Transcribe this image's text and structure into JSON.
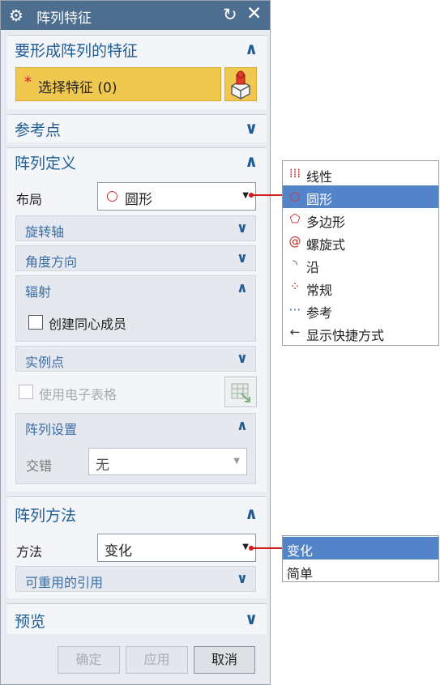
{
  "dialog": {
    "title": "阵列特征",
    "icons": {
      "title_icon": "gear-icon",
      "reset_icon": "reset-icon",
      "close_icon": "close-icon"
    }
  },
  "features": {
    "title": "要形成阵列的特征",
    "select_label": "选择特征 (0)",
    "required_marker": "*"
  },
  "reference": {
    "title": "参考点"
  },
  "definition": {
    "title": "阵列定义",
    "layout_label": "布局",
    "layout_value": "圆形",
    "rotation_axis": "旋转轴",
    "angle_direction": "角度方向",
    "radiate": {
      "title": "辐射",
      "concentric_label": "创建同心成员"
    },
    "instance_points": "实例点",
    "spreadsheet_label": "使用电子表格",
    "array_settings": {
      "title": "阵列设置",
      "stagger_label": "交错",
      "stagger_value": "无"
    }
  },
  "method": {
    "title": "阵列方法",
    "method_label": "方法",
    "method_value": "变化",
    "reusable_refs": "可重用的引用"
  },
  "preview": {
    "title": "预览"
  },
  "buttons": {
    "ok": "确定",
    "apply": "应用",
    "cancel": "取消"
  },
  "layout_menu": {
    "items": [
      {
        "label": "线性",
        "icon": "linear-grid-icon"
      },
      {
        "label": "圆形",
        "icon": "circular-icon",
        "selected": true
      },
      {
        "label": "多边形",
        "icon": "polygon-icon"
      },
      {
        "label": "螺旋式",
        "icon": "spiral-icon"
      },
      {
        "label": "沿",
        "icon": "along-curve-icon"
      },
      {
        "label": "常规",
        "icon": "general-icon"
      },
      {
        "label": "参考",
        "icon": "reference-icon"
      },
      {
        "label": "显示快捷方式",
        "icon": "shortcut-arrow-icon"
      }
    ]
  },
  "method_menu": {
    "items": [
      {
        "label": "变化",
        "selected": true
      },
      {
        "label": "简单"
      }
    ]
  },
  "colors": {
    "titlebar": "#4d6e8e",
    "section_title": "#1f5d97",
    "highlight": "#f0c850",
    "menu_selected": "#5384c9",
    "leader_line": "#d21c1c"
  }
}
